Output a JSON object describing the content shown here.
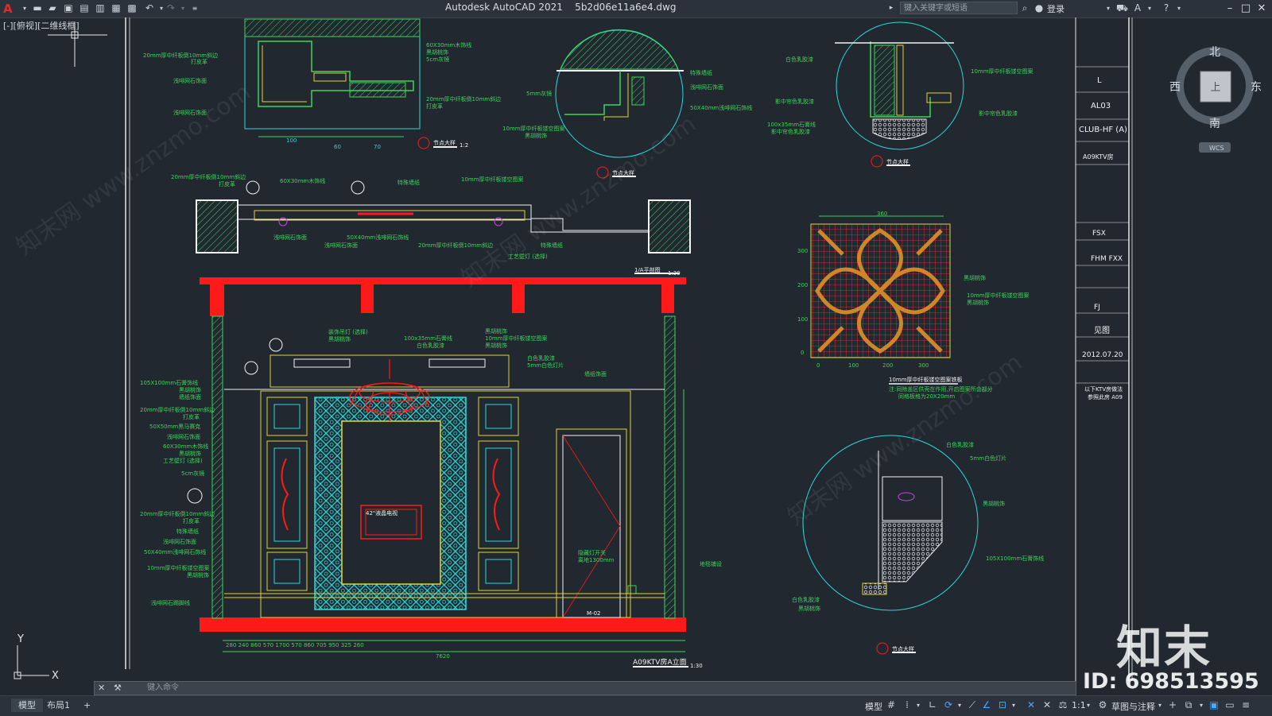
{
  "app": {
    "title": "Autodesk AutoCAD 2021    5b2d06e11a6e4.dwg",
    "search_placeholder": "键入关键字或短语",
    "login_label": "登录"
  },
  "viewport": {
    "label": "[-][俯视][二维线框]"
  },
  "viewcube": {
    "north": "北",
    "south": "南",
    "east": "东",
    "west": "西",
    "top": "上",
    "wcs": "WCS"
  },
  "ucs": {
    "x_label": "X",
    "y_label": "Y"
  },
  "command": {
    "placeholder": "键入命令"
  },
  "layout_tabs": [
    {
      "label": "模型"
    },
    {
      "label": "布局1"
    }
  ],
  "add_tab": "+",
  "status": {
    "model_label": "模型",
    "scale": "1:1",
    "workspace": "草图与注释"
  },
  "drawing": {
    "title_block": {
      "drawing_type": "L",
      "drawing_no": "AL03",
      "project": "CLUB-HF (A)",
      "room": "A09KTV房",
      "designer": "FSX",
      "drawer": "FHM FXX",
      "approver": "FJ",
      "scale": "见图",
      "date": "2012.07.20",
      "note1": "以下KTV房做法",
      "note2": "参照此房 A09"
    },
    "labels": {
      "detail_large": "节点大样",
      "plan_title": "1/A平剖图",
      "plan_scale": "1:30",
      "elevation_title": "A09KTV房A立面",
      "elevation_scale": "1:30",
      "mirror_label": "10mm厚中纤板镂空图案铁板",
      "mirror_note1": "注:同除盖区供壳在作用,开启图案所会部分",
      "mirror_note2": "同格板格为20X20mm",
      "tv_label": "42\"液晶电视",
      "door_label": "M-02",
      "total_width": "7620",
      "dim_row": "280  240  860  570  1700  570  860  705  950  325  260",
      "d1_a": "20mm厚中纤板倒10mm斜边",
      "d1_b": "打皮革",
      "d1_c": "浅啡网石饰面",
      "d1_d": "60X30mm木饰线",
      "d1_e": "黑胡桃饰",
      "d1_f": "5cm灰镜",
      "d2_a": "特殊墙纸",
      "d2_b": "浅啡网石饰面",
      "d2_c": "50X40mm浅啡网石饰线",
      "d2_d": "10mm厚中纤板镂空图案",
      "d2_e": "黑胡桃饰",
      "d2_f": "5mm灰镜",
      "d3_a": "白色乳胶漆",
      "d3_b": "10mm厚中纤板镂空图案",
      "d3_c": "影中帘色乳胶漆",
      "d3_d": "100x35mm石膏线",
      "d3_e": "影中帘色乳胶漆",
      "d4_a": "白色乳胶漆",
      "d4_b": "5mm白色灯片",
      "d4_c": "黑胡桃饰",
      "d4_d": "105X100mm石膏饰线",
      "el_a": "105X100mm石膏饰线",
      "el_b": "20mm厚中纤板倒10mm斜边",
      "el_c": "50X50mm黑马赛克",
      "el_d": "浅啡网石饰面",
      "el_e": "工艺壁灯 (选择)",
      "el_f": "5cm灰镜",
      "el_g": "20mm厚中纤板倒10mm斜边",
      "el_h": "特殊墙纸",
      "el_i": "浅啡网石饰面",
      "el_j": "50X40mm浅啡网石饰线",
      "el_k": "10mm厚中纤板镂空图案",
      "el_l": "浅啡网石踢脚线",
      "el_m": "装饰吊灯 (选择)",
      "el_n": "白色乳胶漆",
      "el_o": "黑胡桃饰",
      "el_p": "5mm白色灯片",
      "el_q": "墙纸饰面",
      "el_r": "地毯铺设",
      "el_s": "隐藏灯开关",
      "el_t": "离地1300mm"
    }
  },
  "watermark": {
    "logo": "知末",
    "id": "ID: 698513595",
    "site": "知末网 www.znzmo.com"
  },
  "colors": {
    "background": "#212830",
    "cad_green": "#3fd35a",
    "cad_yellow": "#e3d23d",
    "cad_cyan": "#2bd8d8",
    "cad_red": "#ff1a1a",
    "cad_white": "#f2f2f2"
  }
}
